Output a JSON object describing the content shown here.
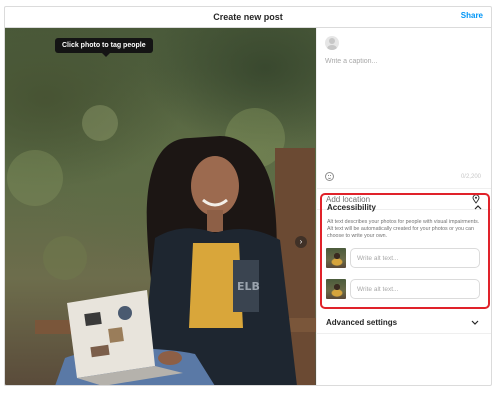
{
  "header": {
    "title": "Create new post",
    "share_label": "Share"
  },
  "photo": {
    "tooltip": "Click photo to tag people"
  },
  "caption": {
    "placeholder": "Write a caption...",
    "char_count": "0/2,200"
  },
  "location": {
    "label": "Add location"
  },
  "accessibility": {
    "title": "Accessibility",
    "description": "Alt text describes your photos for people with visual impairments. Alt text will be automatically created for your photos or you can choose to write your own.",
    "alt_inputs": [
      {
        "placeholder": "Write alt text..."
      },
      {
        "placeholder": "Write alt text..."
      }
    ],
    "highlight_color": "#e0222a"
  },
  "advanced": {
    "label": "Advanced settings"
  },
  "icons": [
    "avatar",
    "emoji-icon",
    "location-pin-icon",
    "chevron-up-icon",
    "chevron-down-icon",
    "next-arrow-icon"
  ],
  "colors": {
    "accent": "#0095f6",
    "border": "#dbdbdb"
  }
}
